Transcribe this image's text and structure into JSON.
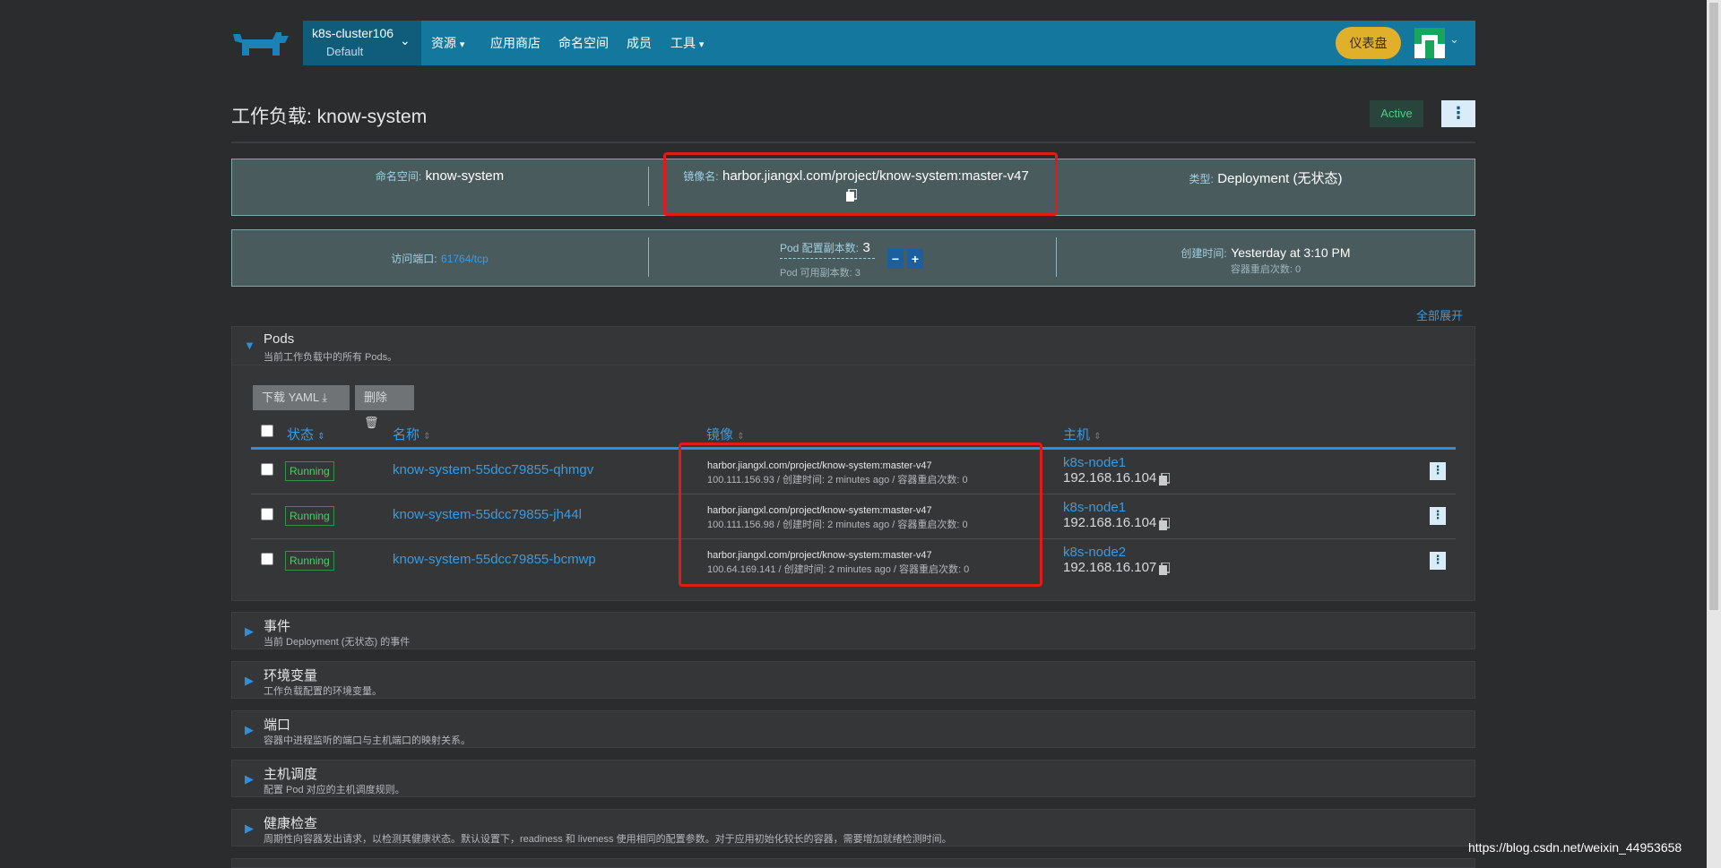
{
  "nav": {
    "cluster_name": "k8s-cluster106",
    "cluster_project": "Default",
    "items": [
      {
        "label": "资源",
        "dropdown": true
      },
      {
        "label": "应用商店",
        "dropdown": false
      },
      {
        "label": "命名空间",
        "dropdown": false
      },
      {
        "label": "成员",
        "dropdown": false
      },
      {
        "label": "工具",
        "dropdown": true
      }
    ],
    "dashboard_button": "仪表盘"
  },
  "page": {
    "title": "工作负载: know-system",
    "status": "Active",
    "more_icon": "⋮"
  },
  "info_top": {
    "namespace_label": "命名空间:",
    "namespace_value": "know-system",
    "image_label": "镜像名:",
    "image_value": "harbor.jiangxl.com/project/know-system:master-v47",
    "type_label": "类型:",
    "type_value": "Deployment (无状态)"
  },
  "info_bottom": {
    "port_label": "访问端口:",
    "port_value": "61764/tcp",
    "replicas_label": "Pod 配置副本数:",
    "replicas_value": "3",
    "available_label": "Pod 可用副本数: 3",
    "created_label": "创建时间:",
    "created_value": "Yesterday at 3:10 PM",
    "restart_label": "容器重启次数: 0"
  },
  "expand_all": "全部展开",
  "pods_section": {
    "title": "Pods",
    "subtitle": "当前工作负载中的所有 Pods。",
    "download_yaml": "下载 YAML",
    "delete": "删除",
    "headers": {
      "status": "状态",
      "name": "名称",
      "image": "镜像",
      "host": "主机"
    },
    "rows": [
      {
        "status": "Running",
        "name": "know-system-55dcc79855-qhmgv",
        "image": "harbor.jiangxl.com/project/know-system:master-v47",
        "detail": "100.111.156.93 / 创建时间: 2 minutes ago / 容器重启次数: 0",
        "node": "k8s-node1",
        "ip": "192.168.16.104"
      },
      {
        "status": "Running",
        "name": "know-system-55dcc79855-jh44l",
        "image": "harbor.jiangxl.com/project/know-system:master-v47",
        "detail": "100.111.156.98 / 创建时间: 2 minutes ago / 容器重启次数: 0",
        "node": "k8s-node1",
        "ip": "192.168.16.104"
      },
      {
        "status": "Running",
        "name": "know-system-55dcc79855-bcmwp",
        "image": "harbor.jiangxl.com/project/know-system:master-v47",
        "detail": "100.64.169.141 / 创建时间: 2 minutes ago / 容器重启次数: 0",
        "node": "k8s-node2",
        "ip": "192.168.16.107"
      }
    ]
  },
  "sections": [
    {
      "title": "事件",
      "subtitle": "当前 Deployment (无状态) 的事件"
    },
    {
      "title": "环境变量",
      "subtitle": "工作负载配置的环境变量。"
    },
    {
      "title": "端口",
      "subtitle": "容器中进程监听的端口与主机端口的映射关系。"
    },
    {
      "title": "主机调度",
      "subtitle": "配置 Pod 对应的主机调度规则。"
    },
    {
      "title": "健康检查",
      "subtitle": "周期性向容器发出请求，以检测其健康状态。默认设置下，readiness 和 liveness 使用相同的配置参数。对于应用初始化较长的容器，需要增加就绪检测时间。"
    }
  ],
  "watermark": "https://blog.csdn.net/weixin_44953658"
}
